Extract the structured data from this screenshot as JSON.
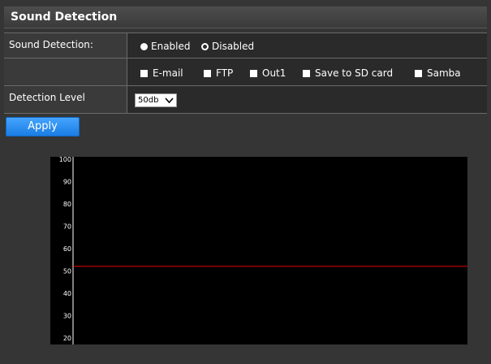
{
  "header": {
    "title": "Sound Detection"
  },
  "sound_detection": {
    "label": "Sound Detection:",
    "options": [
      {
        "label": "Enabled",
        "selected": true
      },
      {
        "label": "Disabled",
        "selected": false
      }
    ]
  },
  "actions": {
    "options": [
      {
        "label": "E-mail",
        "checked": true
      },
      {
        "label": "FTP",
        "checked": true
      },
      {
        "label": "Out1",
        "checked": true
      },
      {
        "label": "Save to SD card",
        "checked": true
      },
      {
        "label": "Samba",
        "checked": true
      }
    ]
  },
  "detection_level": {
    "label": "Detection Level",
    "selected": "50db"
  },
  "apply_button": {
    "label": "Apply"
  },
  "colors": {
    "accent": "#1a7de3",
    "threshold_line": "#e00000",
    "chart_background": "#000000"
  },
  "chart_data": {
    "type": "line",
    "ylim": [
      17,
      101
    ],
    "y_ticks": [
      100,
      90,
      80,
      70,
      60,
      50,
      40,
      30,
      20
    ],
    "series": [
      {
        "values": [
          52,
          52
        ]
      }
    ]
  }
}
